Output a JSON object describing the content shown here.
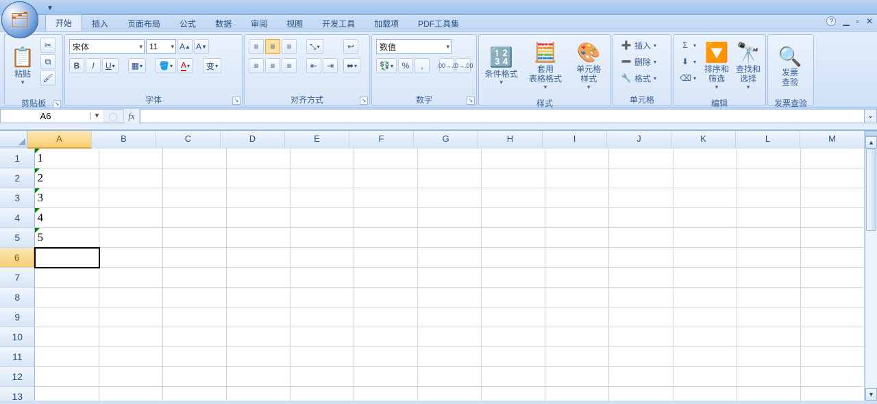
{
  "tabs": {
    "t0": "开始",
    "t1": "插入",
    "t2": "页面布局",
    "t3": "公式",
    "t4": "数据",
    "t5": "审阅",
    "t6": "视图",
    "t7": "开发工具",
    "t8": "加载项",
    "t9": "PDF工具集"
  },
  "ribbon": {
    "clipboard": {
      "title": "剪贴板",
      "paste": "粘贴"
    },
    "font": {
      "title": "字体",
      "name": "宋体",
      "size": "11"
    },
    "align": {
      "title": "对齐方式"
    },
    "number": {
      "title": "数字",
      "format": "数值"
    },
    "styles": {
      "title": "样式",
      "cond": "条件格式",
      "table": "套用\n表格格式",
      "cell": "单元格\n样式"
    },
    "cells": {
      "title": "单元格",
      "insert": "插入",
      "delete": "删除",
      "format": "格式"
    },
    "editing": {
      "title": "编辑",
      "sort": "排序和\n筛选",
      "find": "查找和\n选择"
    },
    "invoice": {
      "title": "发票查验",
      "btn": "发票\n查验"
    }
  },
  "namebox": "A6",
  "columns": [
    "A",
    "B",
    "C",
    "D",
    "E",
    "F",
    "G",
    "H",
    "I",
    "J",
    "K",
    "L",
    "M"
  ],
  "rows": [
    "1",
    "2",
    "3",
    "4",
    "5",
    "6",
    "7",
    "8",
    "9",
    "10",
    "11",
    "12",
    "13"
  ],
  "selected_row": 6,
  "cells": {
    "A1": "1",
    "A2": "2",
    "A3": "3",
    "A4": "4",
    "A5": "5"
  }
}
